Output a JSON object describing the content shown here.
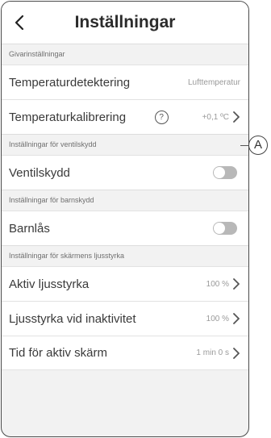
{
  "header": {
    "title": "Inställningar",
    "back_icon": "chevron-left-icon"
  },
  "sections": {
    "sensor": {
      "heading": "Givarinställningar",
      "temp_detection": {
        "label": "Temperaturdetektering",
        "value": "Lufttemperatur"
      },
      "temp_calibration": {
        "label": "Temperaturkalibrering",
        "help": "?",
        "value": "+0,1 ºC"
      }
    },
    "valve": {
      "heading": "Inställningar för ventilskydd",
      "valve_protection": {
        "label": "Ventilskydd",
        "state": "off"
      }
    },
    "child": {
      "heading": "Inställningar för barnskydd",
      "child_lock": {
        "label": "Barnlås",
        "state": "off"
      }
    },
    "brightness": {
      "heading": "Inställningar för skärmens ljusstyrka",
      "active": {
        "label": "Aktiv ljusstyrka",
        "value": "100 %"
      },
      "inactive": {
        "label": "Ljusstyrka vid inaktivitet",
        "value": "100 %"
      },
      "screen_time": {
        "label": "Tid för aktiv skärm",
        "value": "1 min 0 s"
      }
    }
  },
  "callout": {
    "label": "A"
  },
  "colors": {
    "background": "#f2f2f2",
    "row": "#ffffff",
    "toggle_off": "#b8b8b8"
  }
}
